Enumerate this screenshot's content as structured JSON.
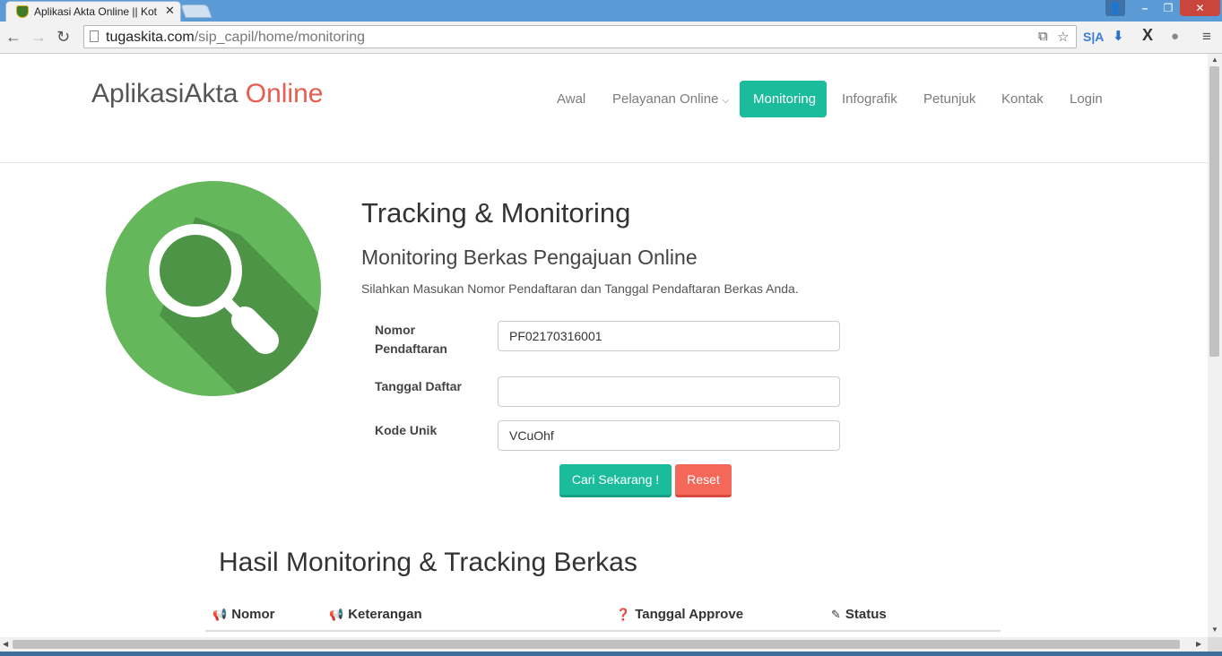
{
  "browser": {
    "tab_title": "Aplikasi Akta Online || Kot",
    "url_domain": "tugaskita.com",
    "url_path": "/sip_capil/home/monitoring",
    "extension_sa": "S|A"
  },
  "site": {
    "brand_main": "AplikasiAkta",
    "brand_accent": "Online",
    "accent_color": "#e95d4f",
    "primary_color": "#1abc9c"
  },
  "nav": {
    "items": [
      "Awal",
      "Pelayanan Online",
      "Monitoring",
      "Infografik",
      "Petunjuk",
      "Kontak",
      "Login"
    ],
    "active": "Monitoring"
  },
  "main": {
    "title": "Tracking & Monitoring",
    "subtitle": "Monitoring Berkas Pengajuan Online",
    "description": "Silahkan Masukan Nomor Pendaftaran dan Tanggal Pendaftaran Berkas Anda."
  },
  "form": {
    "nomor_label_1": "Nomor",
    "nomor_label_2": "Pendaftaran",
    "nomor_value": "PF02170316001",
    "tanggal_label": "Tanggal Daftar",
    "tanggal_value": "",
    "kode_label": "Kode Unik",
    "kode_value": "VCuOhf",
    "search_button": "Cari Sekarang !",
    "reset_button": "Reset"
  },
  "results": {
    "title": "Hasil Monitoring & Tracking Berkas",
    "columns": [
      "Nomor",
      "Keterangan",
      "Tanggal Approve",
      "Status"
    ]
  }
}
